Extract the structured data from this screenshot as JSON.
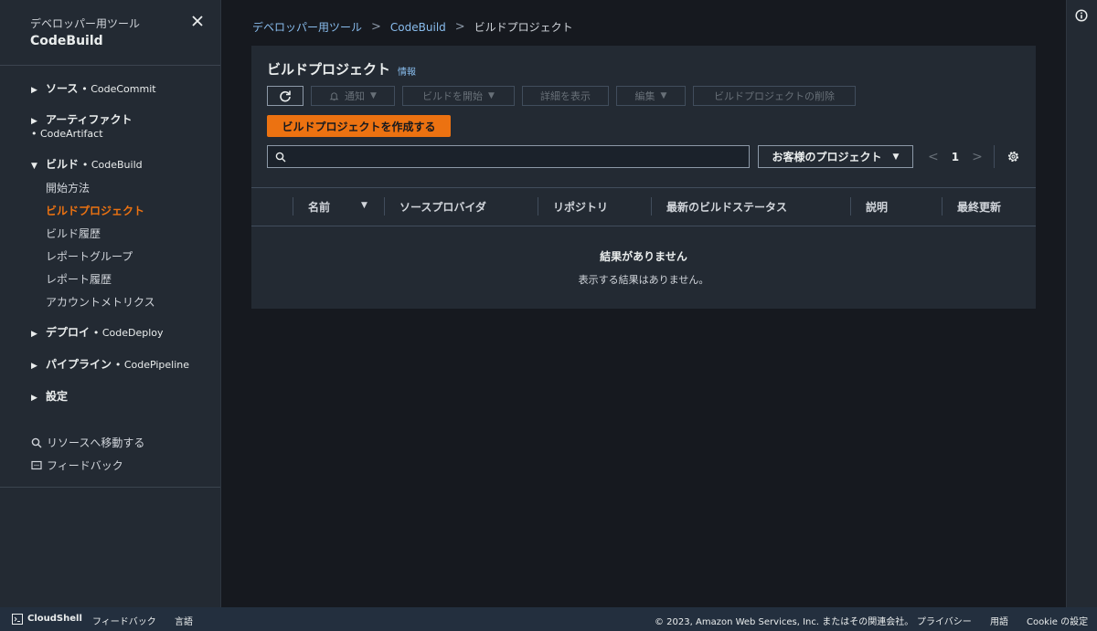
{
  "sidebar": {
    "service_group": "デベロッパー用ツール",
    "title": "CodeBuild",
    "sections": [
      {
        "label": "ソース",
        "service": "• CodeCommit"
      },
      {
        "label": "アーティファクト",
        "service": "• CodeArtifact"
      },
      {
        "label": "ビルド",
        "service": "• CodeBuild"
      },
      {
        "label": "デプロイ",
        "service": "• CodeDeploy"
      },
      {
        "label": "パイプライン",
        "service": "• CodePipeline"
      },
      {
        "label": "設定",
        "service": ""
      }
    ],
    "build_items": [
      "開始方法",
      "ビルドプロジェクト",
      "ビルド履歴",
      "レポートグループ",
      "レポート履歴",
      "アカウントメトリクス"
    ],
    "links": {
      "go_to_resource": "リソースへ移動する",
      "feedback": "フィードバック"
    }
  },
  "breadcrumb": [
    "デベロッパー用ツール",
    "CodeBuild",
    "ビルドプロジェクト"
  ],
  "panel": {
    "title": "ビルドプロジェクト",
    "info": "情報",
    "buttons": {
      "notify": "通知",
      "start_build": "ビルドを開始",
      "view_details": "詳細を表示",
      "edit": "編集",
      "delete": "ビルドプロジェクトの削除",
      "create": "ビルドプロジェクトを作成する"
    },
    "search": {
      "value": "",
      "placeholder": ""
    },
    "filter": "お客様のプロジェクト",
    "page": "1",
    "columns": [
      "名前",
      "ソースプロバイダ",
      "リポジトリ",
      "最新のビルドステータス",
      "説明",
      "最終更新"
    ],
    "empty_title": "結果がありません",
    "empty_desc": "表示する結果はありません。"
  },
  "footer": {
    "cloudshell": "CloudShell",
    "feedback": "フィードバック",
    "language": "言語",
    "copyright": "© 2023, Amazon Web Services, Inc. またはその関連会社。",
    "privacy": "プライバシー",
    "terms": "用語",
    "cookie": "Cookie の設定"
  },
  "colors": {
    "accent": "#ec7211",
    "link": "#89bdee",
    "background": "#16191f",
    "panel": "#232a33"
  }
}
